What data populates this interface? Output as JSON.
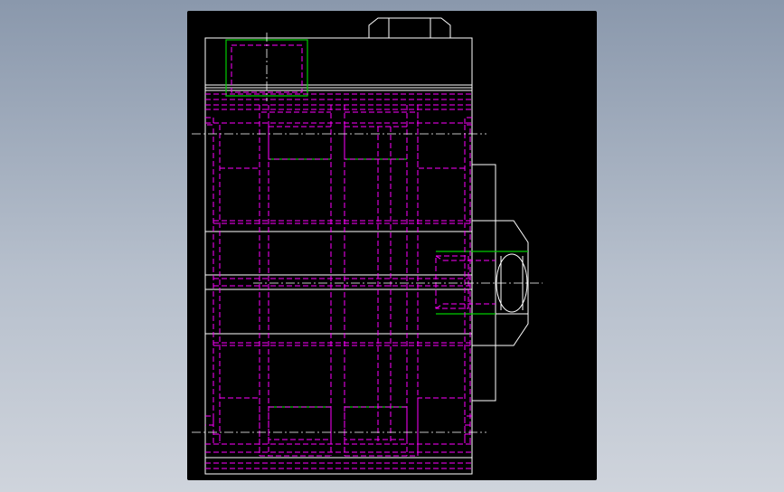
{
  "viewport": {
    "background": "#000000",
    "outside_gradient": [
      "#8a98ac",
      "#cfd4dc"
    ]
  },
  "colors": {
    "outline": "#ffffff",
    "hidden_line": "#ff00ff",
    "highlight": "#00cc00",
    "centerline": "#ffffff"
  },
  "drawing": {
    "view": "side elevation",
    "features": [
      "main-body",
      "top-hex-nut",
      "side-boss",
      "side-hex-nut",
      "centerlines",
      "hidden-lines",
      "highlighted-edges"
    ]
  }
}
